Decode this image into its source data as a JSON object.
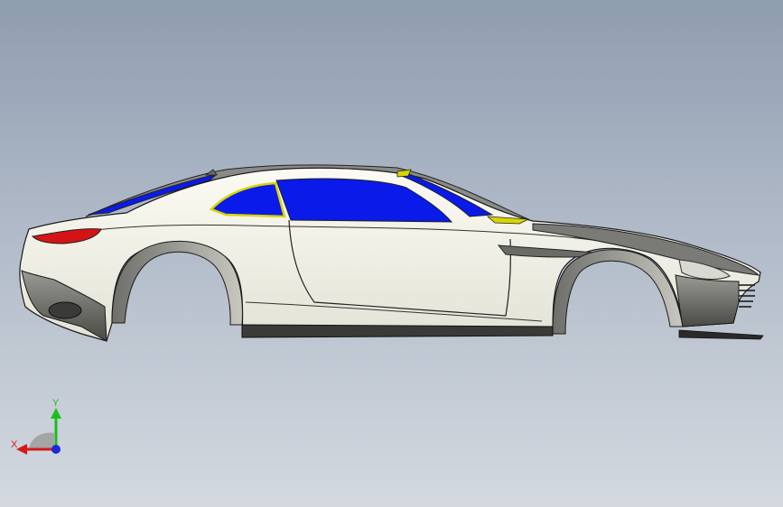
{
  "viewport": {
    "background_top": "#8f9db0",
    "background_bottom": "#d4d9e0"
  },
  "model": {
    "body_color": "#f4f4ea",
    "glass_color": "#0a1ae8",
    "glass_trim_color": "#d8d400",
    "taillight_color": "#d41414",
    "edge_color": "#1a1a1a"
  },
  "triad": {
    "x_label": "X",
    "y_label": "Y",
    "x_color": "#d61a1a",
    "y_color": "#18c018",
    "z_color": "#1a2ad6"
  }
}
